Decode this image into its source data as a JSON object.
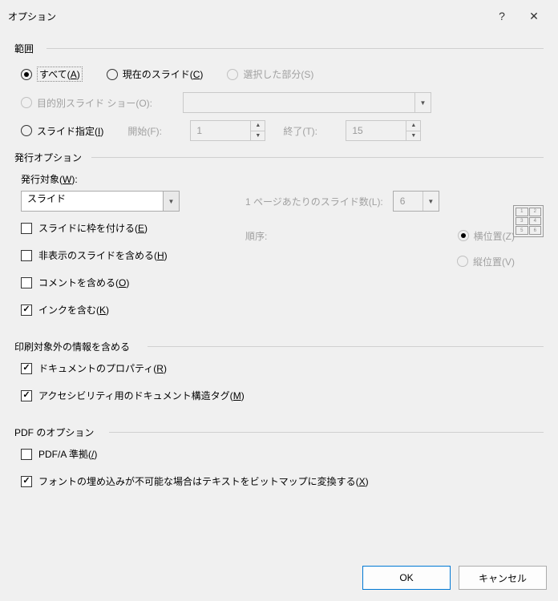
{
  "title": "オプション",
  "range": {
    "heading": "範囲",
    "all": "すべて(",
    "all_key": "A",
    "current": "現在のスライド(",
    "current_key": "C",
    "selected_part": "選択した部分(S)",
    "custom_show": "目的別スライド ショー(O):",
    "slide_spec": "スライド指定(",
    "slide_spec_key": "I",
    "start_lbl": "開始(F):",
    "start_val": "1",
    "end_lbl": "終了(T):",
    "end_val": "15"
  },
  "publish": {
    "heading": "発行オプション",
    "target_lbl": "発行対象(",
    "target_key": "W",
    "target_val": "スライド",
    "slides_per_page": "1 ページあたりのスライド数(L):",
    "spp_val": "6",
    "order_lbl": "順序:",
    "horiz": "横位置(Z)",
    "vert": "縦位置(V)",
    "frame": "スライドに枠を付ける(",
    "frame_key": "E",
    "hidden": "非表示のスライドを含める(",
    "hidden_key": "H",
    "comments": "コメントを含める(",
    "comments_key": "O",
    "ink": "インクを含む(",
    "ink_key": "K"
  },
  "nonprint": {
    "heading": "印刷対象外の情報を含める",
    "docprops": "ドキュメントのプロパティ(",
    "docprops_key": "R",
    "a11y": "アクセシビリティ用のドキュメント構造タグ(",
    "a11y_key": "M"
  },
  "pdf": {
    "heading": "PDF のオプション",
    "pdfa": "PDF/A 準拠(",
    "pdfa_key": "/",
    "bitmap": "フォントの埋め込みが不可能な場合はテキストをビットマップに変換する(",
    "bitmap_key": "X"
  },
  "buttons": {
    "ok": "OK",
    "cancel": "キャンセル"
  },
  "close_paren": ")",
  "colon": "):"
}
